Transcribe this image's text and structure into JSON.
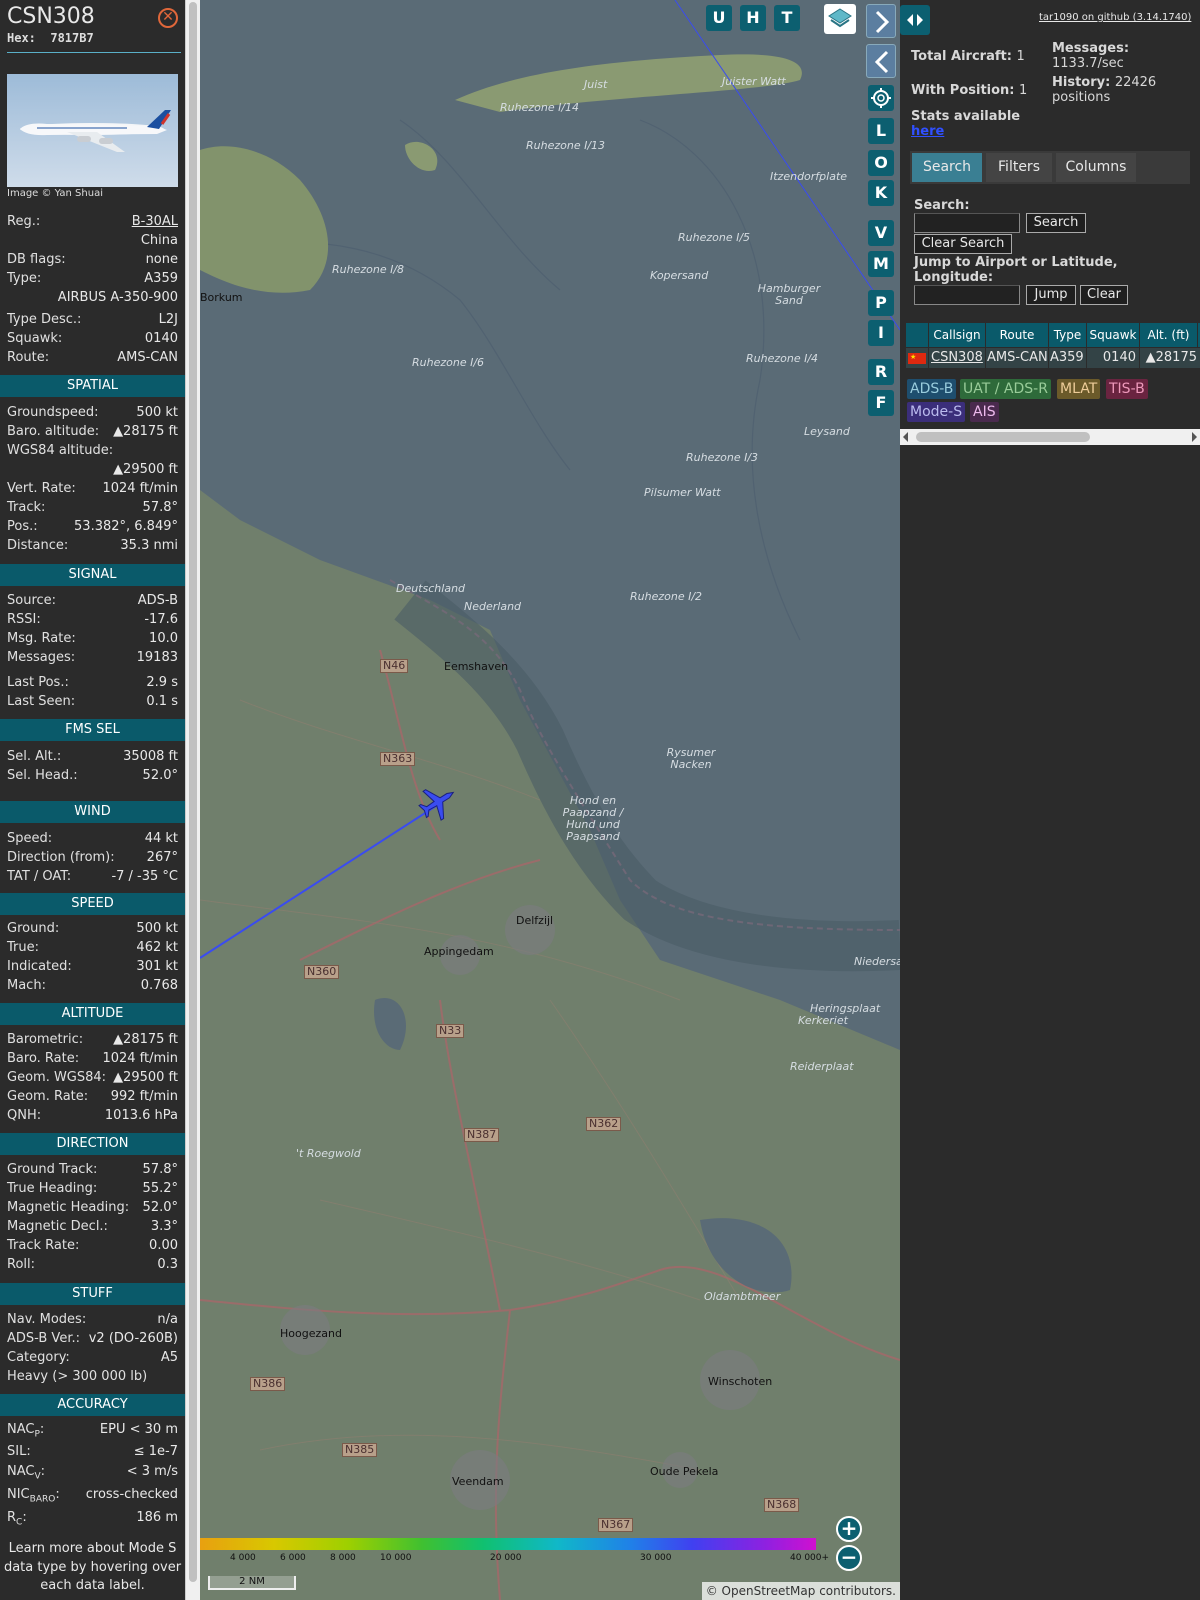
{
  "aircraft": {
    "callsign": "CSN308",
    "hex_label": "Hex:",
    "hex": "7817B7",
    "image_credit": "Image © Yan Shuai",
    "close_icon": "close-x-icon",
    "details": [
      {
        "key": "Reg.:",
        "value": "B-30AL"
      },
      {
        "key": "",
        "value": "China"
      },
      {
        "key": "DB flags:",
        "value": "none"
      },
      {
        "key": "Type:",
        "value": "A359"
      },
      {
        "key": "",
        "value": "AIRBUS A-350-900"
      },
      {
        "key": "Type Desc.:",
        "value": "L2J"
      },
      {
        "key": "Squawk:",
        "value": "0140"
      },
      {
        "key": "Route:",
        "value": "AMS-CAN"
      }
    ]
  },
  "sections": [
    {
      "title": "SPATIAL",
      "rows": [
        {
          "key": "Groundspeed:",
          "value": "500 kt"
        },
        {
          "key": "Baro. altitude:",
          "value": "▲28175 ft"
        },
        {
          "key": "WGS84 altitude:",
          "value": ""
        },
        {
          "key": "",
          "value": "▲29500 ft"
        },
        {
          "key": "Vert. Rate:",
          "value": "1024 ft/min"
        },
        {
          "key": "Track:",
          "value": "57.8°"
        },
        {
          "key": "Pos.:",
          "value": "53.382°, 6.849°"
        },
        {
          "key": "Distance:",
          "value": "35.3 nmi"
        }
      ]
    },
    {
      "title": "SIGNAL",
      "rows": [
        {
          "key": "Source:",
          "value": "ADS-B"
        },
        {
          "key": "RSSI:",
          "value": "-17.6"
        },
        {
          "key": "Msg. Rate:",
          "value": "10.0"
        },
        {
          "key": "Messages:",
          "value": "19183"
        },
        {
          "key": "Last Pos.:",
          "value": "2.9 s"
        },
        {
          "key": "Last Seen:",
          "value": "0.1 s"
        }
      ]
    },
    {
      "title": "FMS SEL",
      "rows": [
        {
          "key": "Sel. Alt.:",
          "value": "35008 ft"
        },
        {
          "key": "Sel. Head.:",
          "value": "52.0°"
        }
      ]
    },
    {
      "title": "WIND",
      "rows": [
        {
          "key": "Speed:",
          "value": "44 kt"
        },
        {
          "key": "Direction (from):",
          "value": "267°"
        },
        {
          "key": "TAT / OAT:",
          "value": "-7 / -35 °C"
        }
      ]
    },
    {
      "title": "SPEED",
      "rows": [
        {
          "key": "Ground:",
          "value": "500 kt"
        },
        {
          "key": "True:",
          "value": "462 kt"
        },
        {
          "key": "Indicated:",
          "value": "301 kt"
        },
        {
          "key": "Mach:",
          "value": "0.768"
        }
      ]
    },
    {
      "title": "ALTITUDE",
      "rows": [
        {
          "key": "Barometric:",
          "value": "▲28175 ft"
        },
        {
          "key": "Baro. Rate:",
          "value": "1024 ft/min"
        },
        {
          "key": "Geom. WGS84:",
          "value": "▲29500 ft"
        },
        {
          "key": "Geom. Rate:",
          "value": "992 ft/min"
        },
        {
          "key": "QNH:",
          "value": "1013.6 hPa"
        }
      ]
    },
    {
      "title": "DIRECTION",
      "rows": [
        {
          "key": "Ground Track:",
          "value": "57.8°"
        },
        {
          "key": "True Heading:",
          "value": "55.2°"
        },
        {
          "key": "Magnetic Heading:",
          "value": "52.0°"
        },
        {
          "key": "Magnetic Decl.:",
          "value": "3.3°"
        },
        {
          "key": "Track Rate:",
          "value": "0.00"
        },
        {
          "key": "Roll:",
          "value": "0.3"
        }
      ]
    },
    {
      "title": "STUFF",
      "rows": [
        {
          "key": "Nav. Modes:",
          "value": "n/a"
        },
        {
          "key": "ADS-B Ver.:",
          "value": "v2 (DO-260B)"
        },
        {
          "key": "Category:",
          "value": "A5"
        },
        {
          "key": "Heavy (> 300 000 lb)",
          "value": ""
        }
      ]
    },
    {
      "title": "ACCURACY",
      "rows": [
        {
          "key": "NACP:",
          "value": "EPU < 30 m"
        },
        {
          "key": "SIL:",
          "value": "≤ 1e-7"
        },
        {
          "key": "NACV:",
          "value": "< 3 m/s"
        },
        {
          "key": "NICBARO:",
          "value": "cross-checked"
        },
        {
          "key": "RC:",
          "value": "186 m"
        }
      ]
    }
  ],
  "info_note": "Learn more about Mode S data type by hovering over each data label.",
  "map": {
    "buttons_top": [
      "U",
      "H",
      "T"
    ],
    "buttons_side": [
      "L",
      "O",
      "K",
      "V",
      "M",
      "P",
      "I",
      "R",
      "F"
    ],
    "labels": [
      "Juist",
      "Juister Watt",
      "Ruhezone I/14",
      "Ruhezone I/13",
      "Itzendorfplate",
      "Borkum",
      "Ruhezone I/8",
      "Ruhezone I/5",
      "Kopersand",
      "Hamburger Sand",
      "Ruhezone I/4",
      "Ruhezone I/6",
      "Leysand",
      "Ruhezone I/3",
      "Pilsumer Watt",
      "Deutschland",
      "Nederland",
      "Ruhezone I/2",
      "Eemshaven",
      "N46",
      "N363",
      "Rysumer Nacken",
      "Hond en Paapzand / Hund und Paapsand",
      "Delfzijl",
      "Appingedam",
      "N360",
      "N33",
      "Heringsplaat",
      "Kerkeriet",
      "Reiderplaat",
      "N387",
      "N362",
      "'t Roegwold",
      "Oldambtmeer",
      "Hoogezand",
      "Winschoten",
      "N386",
      "N385",
      "Veendam",
      "Oude Pekela",
      "N368",
      "N367",
      "Niedersachsen"
    ],
    "altitude_ticks": [
      "4 000",
      "6 000",
      "8 000",
      "10 000",
      "20 000",
      "30 000",
      "40 000+"
    ],
    "scale_label": "2 NM",
    "attribution_prefix": "©",
    "attribution_link": "OpenStreetMap",
    "attribution_suffix": "contributors.",
    "zoom_in": "+",
    "zoom_out": "−"
  },
  "right_panel": {
    "version_link": "tar1090 on github (3.14.1740)",
    "total_aircraft_label": "Total Aircraft:",
    "total_aircraft": "1",
    "with_position_label": "With Position:",
    "with_position": "1",
    "messages_label": "Messages:",
    "messages_rate": "1133.7/sec",
    "history_label": "History:",
    "history_value": "22426",
    "history_unit": "positions",
    "stats_text": "Stats available",
    "stats_link": "here",
    "tabs": [
      "Search",
      "Filters",
      "Columns"
    ],
    "search_label": "Search:",
    "search_button": "Search",
    "clear_search_button": "Clear Search",
    "jump_label": "Jump to Airport or Latitude, Longitude:",
    "jump_button": "Jump",
    "clear_button": "Clear",
    "table": {
      "headers": [
        "Callsign",
        "Route",
        "Type",
        "Squawk",
        "Alt. (ft)"
      ],
      "row": [
        "CSN308",
        "AMS-CAN",
        "A359",
        "0140",
        "▲28175"
      ]
    },
    "sources": [
      {
        "label": "ADS-B",
        "color": "#1e4e6e"
      },
      {
        "label": "UAT / ADS-R",
        "color": "#2e6a3a"
      },
      {
        "label": "MLAT",
        "color": "#6b5a2a"
      },
      {
        "label": "TIS-B",
        "color": "#6a2440"
      },
      {
        "label": "Mode-S",
        "color": "#3b2e7a"
      },
      {
        "label": "AIS",
        "color": "#4a2a4e"
      }
    ]
  }
}
